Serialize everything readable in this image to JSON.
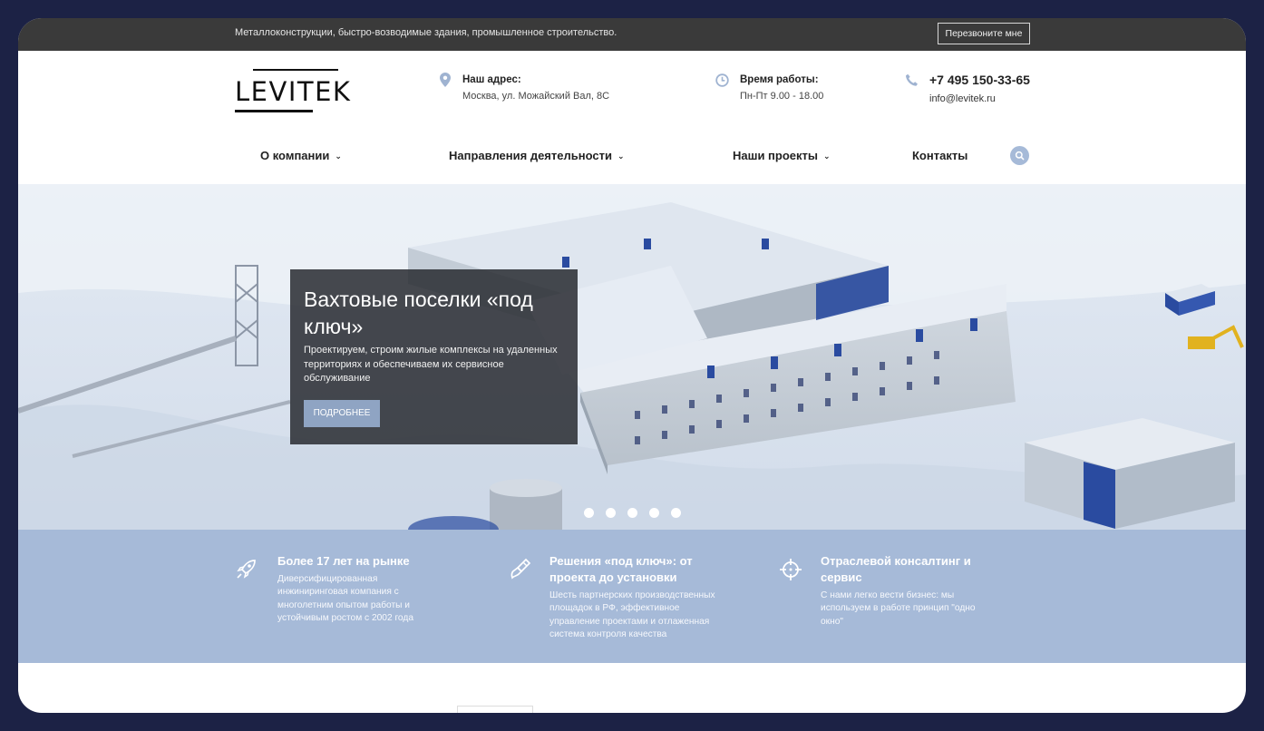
{
  "topbar": {
    "tagline": "Металлоконструкции, быстро-возводимые здания, промышленное строительство.",
    "callback_label": "Перезвоните мне"
  },
  "logo": {
    "text": "LEVITEK"
  },
  "header": {
    "address": {
      "label": "Наш адрес:",
      "value": "Москва, ул. Можайский Вал, 8С",
      "icon": "map-pin-icon"
    },
    "hours": {
      "label": "Время работы:",
      "value": "Пн-Пт 9.00 - 18.00",
      "icon": "clock-icon"
    },
    "contact": {
      "phone": "+7 495 150-33-65",
      "email": "info@levitek.ru",
      "icon": "phone-icon"
    }
  },
  "nav": {
    "items": [
      {
        "label": "О компании",
        "has_dropdown": true
      },
      {
        "label": "Направления деятельности",
        "has_dropdown": true
      },
      {
        "label": "Наши проекты",
        "has_dropdown": true
      },
      {
        "label": "Контакты",
        "has_dropdown": false
      }
    ],
    "search_icon": "search-icon"
  },
  "hero": {
    "title": "Вахтовые поселки «под ключ»",
    "text": "Проектируем, строим жилые комплексы на удаленных территориях и обеспечиваем их сервисное обслуживание",
    "button_label": "ПОДРОБНЕЕ",
    "slide_count": 5,
    "active_slide": 1
  },
  "features": [
    {
      "icon": "rocket-icon",
      "title": "Более 17 лет на рынке",
      "text": "Диверсифицированная инжиниринговая компания с многолетним опытом работы и устойчивым ростом с 2002 года"
    },
    {
      "icon": "brush-icon",
      "title": "Решения «под ключ»: от проекта до установки",
      "text": "Шесть партнерских производственных площадок в РФ, эффективное управление проектами и отлаженная система контроля качества"
    },
    {
      "icon": "crosshair-icon",
      "title": "Отраслевой консалтинг и сервис",
      "text": "С нами легко вести бизнес: мы используем в работе принцип \"одно окно\""
    }
  ],
  "colors": {
    "topbar": "#3a3a3a",
    "accent": "#a6bad8",
    "button": "#8fa4c3",
    "frame": "#1c2245"
  }
}
